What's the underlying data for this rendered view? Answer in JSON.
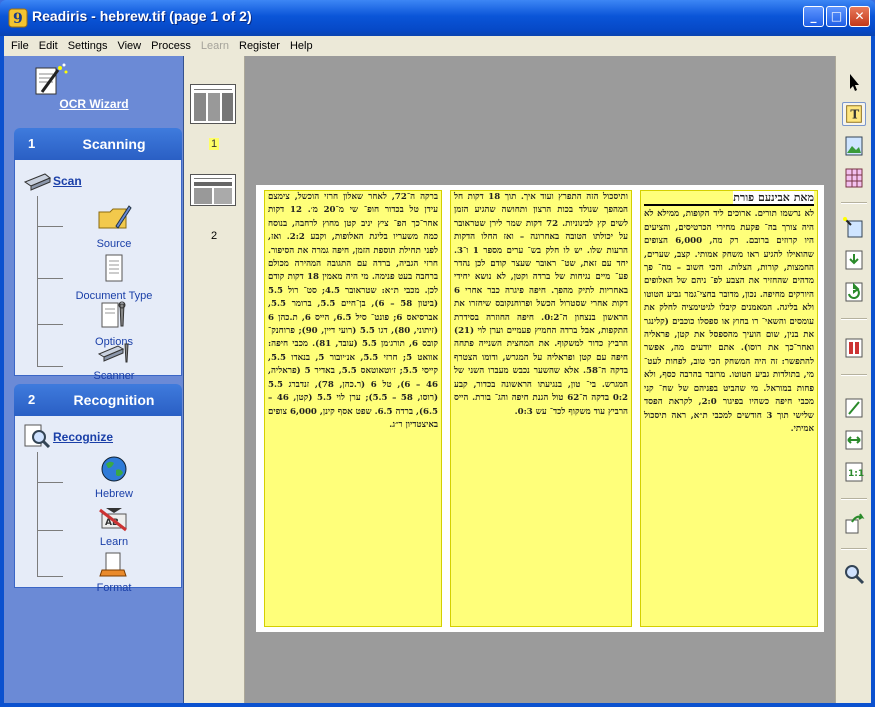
{
  "window": {
    "title": "Readiris - hebrew.tif (page 1 of 2)",
    "minimize": "_",
    "maximize": "□",
    "close": "✕"
  },
  "menu": [
    "File",
    "Edit",
    "Settings",
    "View",
    "Process",
    "Learn",
    "Register",
    "Help"
  ],
  "wizard": {
    "title": "OCR Wizard",
    "step1": {
      "number": "1",
      "label": "Scanning",
      "main": "Scan",
      "items": [
        "Source",
        "Document Type",
        "Options",
        "Scanner"
      ]
    },
    "step2": {
      "number": "2",
      "label": "Recognition",
      "main": "Recognize",
      "items": [
        "Hebrew",
        "Learn",
        "Format"
      ]
    }
  },
  "thumbnails": [
    "1",
    "2"
  ],
  "document": {
    "col_right_heading": "מאת אבינעם פורת",
    "col_right": "לא נרשמו תורים. ארוכים ליד הקופות, ממילא לא היה צורך בה־ פקעת מחירי הכרטיסים, והציעים היו קרוזים ברובם. רק מה, 6,000 הצופים שהואילו להגיע ראו משחק אמותי. קצב, שערים, החמצות, קורות, הצלות. והכי חשוב – מה־ פך מדהים שהחזיר את הצבע לפ־ ניהם של האלופים היורקים מחיפה. נכון, מדובר בחצי־גמר גביע הטוטו ולא בליגה. המאמנים קיבלו לגיטימציה לחלק את עומסים והשאי־ רו בחוץ או ספסלו כוכבים (קלינגר את בנין, שום הועיך מהספסל את קטן, פראליה ואחר־כך את רוסו). אתם יודעים מה, אפשר להתפשר: זה היה המשחק הכי טוב, לפחות לעט־ מי, בתולדות גביע הטוטו. מרובר בהרבה כסף, ולא פחות במוראל. מי שהביט בפניהם של שח־ קני מכבי חיפה כשהיו בפיגור 2:0, לקראת הפסד שלישי תוך 3 חודשים למכבי ת״א, ראה תיסכול אמיתי.",
    "col_middle": "ותיסכול הזה התפרץ ועוד איך. תוך 18 דקות חל המהפך שנולד בכות הרצון ותחושה שהגיע הזמן לשים קץ לבינוניות. 72 דקות שמר לירן שטראובר על יכולתו הטובה באחרונה – ואז החלו הדקות הרעות שלו. יש לו חלק בש־ ערים מספר 1 ו־3. יחד עם זאת, שט־ ראובר שעצר קודם לכן נהדר פע־ מיים נגיחות של ברדה וקטן, לא נושא יחידי באחריות לתיק מהפך. חיפה פיגרה כבר אחרי 6 דקות אחרי שסטרול הכשל ופרוחנקובס שיחזרו את הראשון בנצחון ה־0:2. חיפה החוזרה בסידרת התקפות, אבל ברדה החמיץ פעמיים וערן לוי (21) הרביץ כדור למשקוף. את המחצית השנייה פתחה חיפה עם קטן ופראליה על המגרש, ודומו הצטרף בדקה ה־58. אלא שהשער נכבש מעברו השני של המגרש. בי־ טון, בנגיעתו הראשונה בכדור, קבע 0:2 בדקה ה־62 טול הגנת חיפה והג־ בורת. הייס הרביץ עוד משקוף לכד־ עש 0:3.",
    "col_left": "ברקה ה־72, לאחר שאלון חרזי הוכשל, צימצם עידן טל בכדור חופ־ שי מ־20 מ׳. 12 דקות אחר־כך הפ־ ציץ יניב קטן מחוץ לרחבה, בנוסח כמה משעריו בליגת האלופות, וקבע 2:2. ואז, לפני תחילת תוספת הזמן, חיפה גמרה את הסיפור. חרזי הגביה, ברדה עם התגובה המהירה מכולם ברחבה בעט פנימה. מי היה מאמין 18 דקות קודם לכן. מכבי ת״א: שטראובר 4.5; סט־ רול 5.5 (ביטון 58 – 6), בן־חיים 5.5, ברומר 5.5, אברסיאס 6; פונט־ סיל 6.5, הייס 6, ת.כהן 6 (זיתוני, 80), דגו 5.5 (רועי דיין, 90); פרוחנק־ קובס 6, תורג׳מן 5.5 (עובד, 81). מכבי חיפה: אוואט 5; חרזי 5.5, אנ׳יובור 5, בנאדו 5.5, קייסי 5.5; ז׳וטאוטאס 5.5, באדיר 5 (פראליה, 46 – 6), טל 6 (ר.כהן, 78), זנדברג 5.5 (רוסו, 58 – 5.5); ערן לוי 5.5 (קטן, 46 – 6.5), ברדה 6.5. שפט אסף קינן, 6,000 צופים באיצטדיון ר״ג."
  }
}
